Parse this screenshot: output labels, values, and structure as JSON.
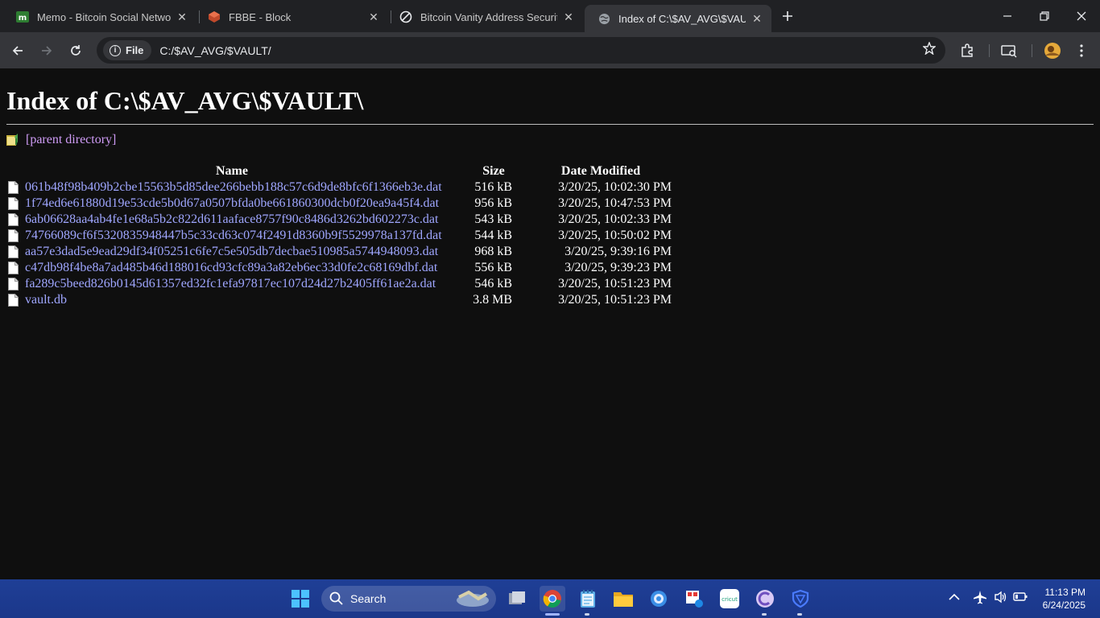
{
  "tabs": [
    {
      "title": "Memo - Bitcoin Social Network",
      "icon": "memo-favicon-icon",
      "close": "✕"
    },
    {
      "title": "FBBE - Block",
      "icon": "fbbe-favicon-icon",
      "close": "✕"
    },
    {
      "title": "Bitcoin Vanity Address Security",
      "icon": "link-favicon-icon",
      "close": "✕"
    },
    {
      "title": "Index of C:\\$AV_AVG\\$VAULT\\",
      "icon": "globe-favicon-icon",
      "close": "✕"
    }
  ],
  "toolbar": {
    "chip_label": "File",
    "url": "C:/$AV_AVG/$VAULT/"
  },
  "page": {
    "heading": "Index of C:\\$AV_AVG\\$VAULT\\",
    "parent_link": "[parent directory]",
    "columns": {
      "name": "Name",
      "size": "Size",
      "date": "Date Modified"
    },
    "files": [
      {
        "name": "061b48f98b409b2cbe15563b5d85dee266bebb188c57c6d9de8bfc6f1366eb3e.dat",
        "size": "516 kB",
        "date": "3/20/25, 10:02:30 PM"
      },
      {
        "name": "1f74ed6e61880d19e53cde5b0d67a0507bfda0be661860300dcb0f20ea9a45f4.dat",
        "size": "956 kB",
        "date": "3/20/25, 10:47:53 PM"
      },
      {
        "name": "6ab06628aa4ab4fe1e68a5b2c822d611aaface8757f90c8486d3262bd602273c.dat",
        "size": "543 kB",
        "date": "3/20/25, 10:02:33 PM"
      },
      {
        "name": "74766089cf6f5320835948447b5c33cd63c074f2491d8360b9f5529978a137fd.dat",
        "size": "544 kB",
        "date": "3/20/25, 10:50:02 PM"
      },
      {
        "name": "aa57e3dad5e9ead29df34f05251c6fe7c5e505db7decbae510985a5744948093.dat",
        "size": "968 kB",
        "date": "3/20/25, 9:39:16 PM"
      },
      {
        "name": "c47db98f4be8a7ad485b46d188016cd93cfc89a3a82eb6ec33d0fe2c68169dbf.dat",
        "size": "556 kB",
        "date": "3/20/25, 9:39:23 PM"
      },
      {
        "name": "fa289c5beed826b0145d61357ed32fc1efa97817ec107d24d27b2405ff61ae2a.dat",
        "size": "546 kB",
        "date": "3/20/25, 10:51:23 PM"
      },
      {
        "name": "vault.db",
        "size": "3.8 MB",
        "date": "3/20/25, 10:51:23 PM"
      }
    ]
  },
  "taskbar": {
    "search_label": "Search",
    "time": "11:13 PM",
    "date": "6/24/2025"
  },
  "colors": {
    "link": "#9fa6ff",
    "visited_link": "#cf9cf6",
    "page_bg": "#0f0f0f",
    "taskbar_bg": "#1b378a"
  }
}
